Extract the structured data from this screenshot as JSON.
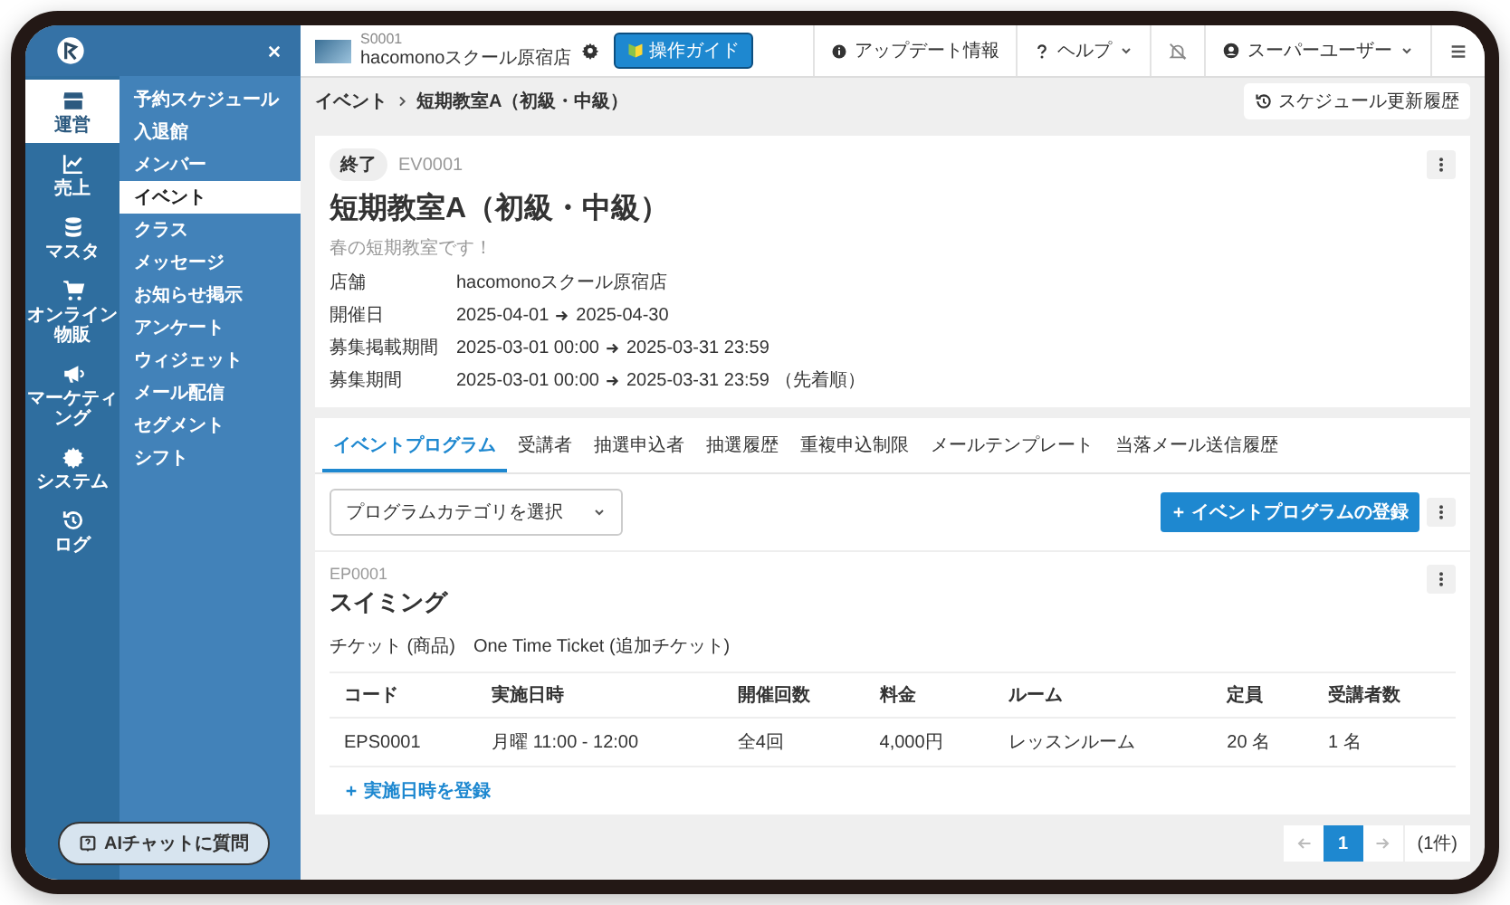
{
  "sidebar": {
    "rail": [
      {
        "label": "運営",
        "selected": true
      },
      {
        "label": "売上",
        "selected": false
      },
      {
        "label": "マスタ",
        "selected": false
      },
      {
        "label": "オンライン物販",
        "selected": false
      },
      {
        "label": "マーケティング",
        "selected": false
      },
      {
        "label": "システム",
        "selected": false
      },
      {
        "label": "ログ",
        "selected": false
      }
    ],
    "menu": [
      {
        "label": "予約スケジュール",
        "selected": false
      },
      {
        "label": "入退館",
        "selected": false
      },
      {
        "label": "メンバー",
        "selected": false
      },
      {
        "label": "イベント",
        "selected": true
      },
      {
        "label": "クラス",
        "selected": false
      },
      {
        "label": "メッセージ",
        "selected": false
      },
      {
        "label": "お知らせ掲示",
        "selected": false
      },
      {
        "label": "アンケート",
        "selected": false
      },
      {
        "label": "ウィジェット",
        "selected": false
      },
      {
        "label": "メール配信",
        "selected": false
      },
      {
        "label": "セグメント",
        "selected": false
      },
      {
        "label": "シフト",
        "selected": false
      }
    ],
    "ai_button": "AIチャットに質問"
  },
  "topbar": {
    "store_code": "S0001",
    "store_name": "hacomonoスクール原宿店",
    "guide_button": "操作ガイド",
    "update_info": "アップデート情報",
    "help": "ヘルプ",
    "user": "スーパーユーザー"
  },
  "breadcrumb": [
    "イベント",
    "短期教室A（初級・中級）"
  ],
  "history_button": "スケジュール更新履歴",
  "event": {
    "status": "終了",
    "code": "EV0001",
    "title": "短期教室A（初級・中級）",
    "description": "春の短期教室です！",
    "details": [
      {
        "kind": "text",
        "label": "店舗",
        "value": "hacomonoスクール原宿店"
      },
      {
        "kind": "range",
        "label": "開催日",
        "from": "2025-04-01",
        "to": "2025-04-30"
      },
      {
        "kind": "range",
        "label": "募集掲載期間",
        "from": "2025-03-01 00:00",
        "to": "2025-03-31 23:59"
      },
      {
        "kind": "range",
        "label": "募集期間",
        "from": "2025-03-01 00:00",
        "to": "2025-03-31 23:59",
        "note": "（先着順）"
      }
    ]
  },
  "tabs": [
    {
      "label": "イベントプログラム",
      "selected": true
    },
    {
      "label": "受講者",
      "selected": false
    },
    {
      "label": "抽選申込者",
      "selected": false
    },
    {
      "label": "抽選履歴",
      "selected": false
    },
    {
      "label": "重複申込制限",
      "selected": false
    },
    {
      "label": "メールテンプレート",
      "selected": false
    },
    {
      "label": "当落メール送信履歴",
      "selected": false
    }
  ],
  "category_select": {
    "value": "プログラムカテゴリを選択"
  },
  "add_program_button": "イベントプログラムの登録",
  "program": {
    "code": "EP0001",
    "title": "スイミング",
    "ticket_label": "チケット (商品)",
    "ticket_value": "One Time Ticket (追加チケット)",
    "table": {
      "columns": [
        "コード",
        "実施日時",
        "開催回数",
        "料金",
        "ルーム",
        "定員",
        "受講者数"
      ],
      "rows": [
        [
          "EPS0001",
          "月曜 11:00 - 12:00",
          "全4回",
          "4,000円",
          "レッスンルーム",
          "20 名",
          "1 名"
        ]
      ]
    },
    "add_schedule_link": "実施日時を登録"
  },
  "pagination": {
    "pages": [
      {
        "label": "1",
        "selected": true
      }
    ],
    "count": "(1件)"
  }
}
